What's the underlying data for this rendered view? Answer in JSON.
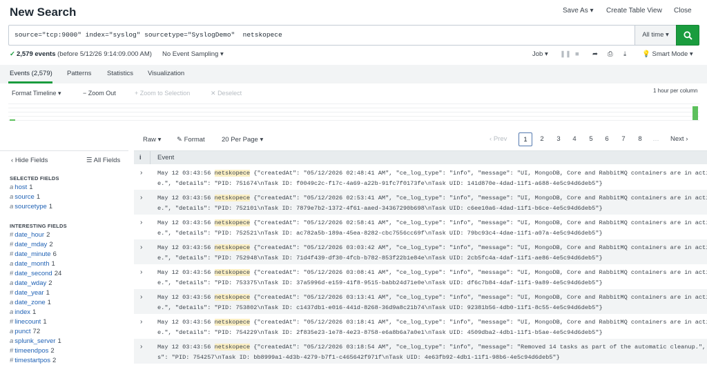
{
  "header": {
    "title": "New Search",
    "save_as": "Save As",
    "create_table_view": "Create Table View",
    "close": "Close"
  },
  "search": {
    "query": "source=\"tcp:9000\" index=\"syslog\" sourcetype=\"SyslogDemo\"  netskopece",
    "time_range": "All time",
    "time_caret": "▾"
  },
  "status": {
    "count": "2,579 events",
    "before": "(before 5/12/26 9:14:09.000 AM)",
    "sampling": "No Event Sampling",
    "job": "Job",
    "mode": "Smart Mode"
  },
  "tabs": [
    "Events (2,579)",
    "Patterns",
    "Statistics",
    "Visualization"
  ],
  "timeline": {
    "format": "Format Timeline",
    "zoom_out": "Zoom Out",
    "zoom_selection": "Zoom to Selection",
    "deselect": "Deselect",
    "scale": "1 hour per column",
    "bucket_fill": 1.0
  },
  "controls": {
    "raw": "Raw",
    "format": "Format",
    "per_page": "20 Per Page",
    "prev": "Prev",
    "pages": [
      "1",
      "2",
      "3",
      "4",
      "5",
      "6",
      "7",
      "8"
    ],
    "ellipsis": "…",
    "next": "Next"
  },
  "sidebar": {
    "hide_fields": "Hide Fields",
    "all_fields": "All Fields",
    "selected_title": "SELECTED FIELDS",
    "selected": [
      {
        "type": "a",
        "name": "host",
        "count": "1"
      },
      {
        "type": "a",
        "name": "source",
        "count": "1"
      },
      {
        "type": "a",
        "name": "sourcetype",
        "count": "1"
      }
    ],
    "interesting_title": "INTERESTING FIELDS",
    "interesting": [
      {
        "type": "#",
        "name": "date_hour",
        "count": "2"
      },
      {
        "type": "#",
        "name": "date_mday",
        "count": "2"
      },
      {
        "type": "#",
        "name": "date_minute",
        "count": "6"
      },
      {
        "type": "a",
        "name": "date_month",
        "count": "1"
      },
      {
        "type": "#",
        "name": "date_second",
        "count": "24"
      },
      {
        "type": "a",
        "name": "date_wday",
        "count": "2"
      },
      {
        "type": "#",
        "name": "date_year",
        "count": "1"
      },
      {
        "type": "a",
        "name": "date_zone",
        "count": "1"
      },
      {
        "type": "a",
        "name": "index",
        "count": "1"
      },
      {
        "type": "#",
        "name": "linecount",
        "count": "1"
      },
      {
        "type": "a",
        "name": "punct",
        "count": "72"
      },
      {
        "type": "a",
        "name": "splunk_server",
        "count": "1"
      },
      {
        "type": "#",
        "name": "timeendpos",
        "count": "2"
      },
      {
        "type": "#",
        "name": "timestartpos",
        "count": "2"
      }
    ]
  },
  "results": {
    "col_i": "i",
    "col_event": "Event",
    "keyword": "netskopece",
    "events": [
      {
        "time": "May 12 03:43:56 ",
        "rest1": " {\"createdAt\": \"05/12/2026 02:48:41 AM\", \"ce_log_type\": \"info\", \"message\": \"UI, MongoDB, Core and RabbitMQ containers are in active stat",
        "line2": "e.\", \"details\": \"PID: 751674\\nTask ID: f0049c2c-f17c-4a69-a22b-91fc7f0173fe\\nTask UID: 141d870e-4dad-11f1-a688-4e5c94d6deb5\"}"
      },
      {
        "time": "May 12 03:43:56 ",
        "rest1": " {\"createdAt\": \"05/12/2026 02:53:41 AM\", \"ce_log_type\": \"info\", \"message\": \"UI, MongoDB, Core and RabbitMQ containers are in active stat",
        "line2": "e.\", \"details\": \"PID: 752101\\nTask ID: 7879e7b2-1372-4f61-aaed-34367290b698\\nTask UID: c6ee10a6-4dad-11f1-b6ce-4e5c94d6deb5\"}"
      },
      {
        "time": "May 12 03:43:56 ",
        "rest1": " {\"createdAt\": \"05/12/2026 02:58:41 AM\", \"ce_log_type\": \"info\", \"message\": \"UI, MongoDB, Core and RabbitMQ containers are in active stat",
        "line2": "e.\", \"details\": \"PID: 752521\\nTask ID: ac782a5b-189a-45ea-8282-cbc7556cc69f\\nTask UID: 79bc93c4-4dae-11f1-a07a-4e5c94d6deb5\"}"
      },
      {
        "time": "May 12 03:43:56 ",
        "rest1": " {\"createdAt\": \"05/12/2026 03:03:42 AM\", \"ce_log_type\": \"info\", \"message\": \"UI, MongoDB, Core and RabbitMQ containers are in active stat",
        "line2": "e.\", \"details\": \"PID: 752948\\nTask ID: 71d4f439-df30-4fcb-b782-853f22b1e84e\\nTask UID: 2cb5fc4a-4daf-11f1-ae86-4e5c94d6deb5\"}"
      },
      {
        "time": "May 12 03:43:56 ",
        "rest1": " {\"createdAt\": \"05/12/2026 03:08:41 AM\", \"ce_log_type\": \"info\", \"message\": \"UI, MongoDB, Core and RabbitMQ containers are in active stat",
        "line2": "e.\", \"details\": \"PID: 753375\\nTask ID: 37a5996d-e159-41f8-9515-babb24d71e0e\\nTask UID: df6c7b84-4daf-11f1-9a89-4e5c94d6deb5\"}"
      },
      {
        "time": "May 12 03:43:56 ",
        "rest1": " {\"createdAt\": \"05/12/2026 03:13:41 AM\", \"ce_log_type\": \"info\", \"message\": \"UI, MongoDB, Core and RabbitMQ containers are in active stat",
        "line2": "e.\", \"details\": \"PID: 753802\\nTask ID: c1437db1-e016-441d-8268-36d9a8c21b74\\nTask UID: 92381b56-4db0-11f1-8c55-4e5c94d6deb5\"}"
      },
      {
        "time": "May 12 03:43:56 ",
        "rest1": " {\"createdAt\": \"05/12/2026 03:18:41 AM\", \"ce_log_type\": \"info\", \"message\": \"UI, MongoDB, Core and RabbitMQ containers are in active stat",
        "line2": "e.\", \"details\": \"PID: 754229\\nTask ID: 2f835e23-1e78-4e23-8758-e6a8b6a7a0e1\\nTask UID: 4509dba2-4db1-11f1-b5ae-4e5c94d6deb5\"}"
      },
      {
        "time": "May 12 03:43:56 ",
        "rest1": " {\"createdAt\": \"05/12/2026 03:18:54 AM\", \"ce_log_type\": \"info\", \"message\": \"Removed 14 tasks as part of the automatic cleanup.\", \"detail",
        "line2": "s\": \"PID: 754257\\nTask ID: bb8999a1-4d3b-4279-b7f1-c465642f971f\\nTask UID: 4e63fb92-4db1-11f1-98b6-4e5c94d6deb5\"}"
      }
    ]
  },
  "colors": {
    "accent_green": "#1a9c3e",
    "link_blue": "#2062b5",
    "highlight": "#fbefc3"
  }
}
